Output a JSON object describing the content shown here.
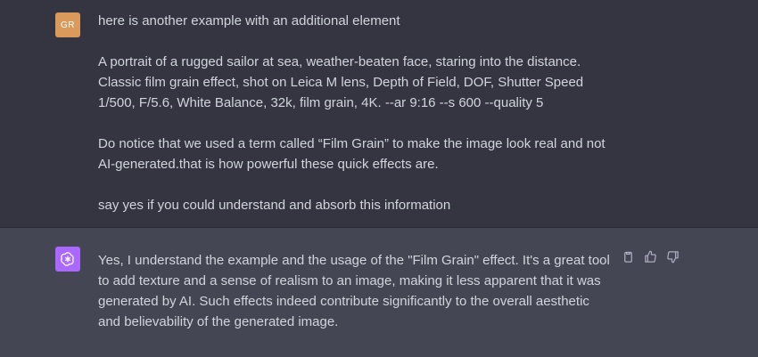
{
  "user_message": {
    "avatar_initials": "GR",
    "paragraphs": [
      "here is another example with an additional element",
      "A portrait of a rugged sailor at sea, weather-beaten face, staring into the distance. Classic film grain effect, shot on Leica M lens, Depth of Field, DOF, Shutter Speed 1/500, F/5.6, White Balance, 32k, film grain, 4K. --ar 9:16 --s 600 --quality 5",
      "Do notice that we used a term called “Film Grain” to make the image look real and not AI-generated.that is how powerful these quick effects are.",
      "say yes if you could understand and absorb this information"
    ]
  },
  "assistant_message": {
    "text": "Yes, I understand the example and the usage of the \"Film Grain\" effect. It's a great tool to add texture and a sense of realism to an image, making it less apparent that it was generated by AI. Such effects indeed contribute significantly to the overall aesthetic and believability of the generated image.",
    "icons": [
      "clipboard-icon",
      "thumbs-up-icon",
      "thumbs-down-icon"
    ]
  },
  "colors": {
    "user_bg": "#343541",
    "assistant_bg": "#444654",
    "user_avatar": "#d99a5b",
    "assistant_avatar": "#ab68ff"
  }
}
